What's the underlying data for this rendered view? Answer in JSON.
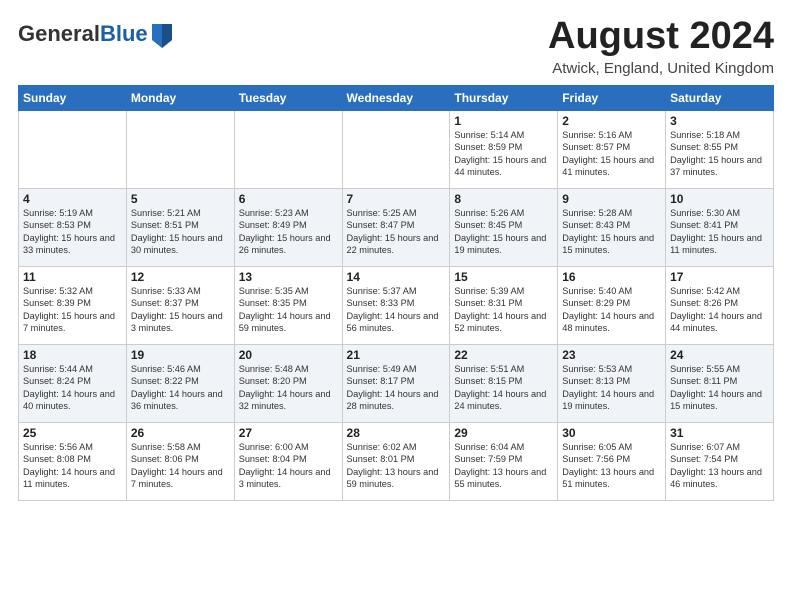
{
  "header": {
    "logo_general": "General",
    "logo_blue": "Blue",
    "month": "August 2024",
    "location": "Atwick, England, United Kingdom"
  },
  "weekdays": [
    "Sunday",
    "Monday",
    "Tuesday",
    "Wednesday",
    "Thursday",
    "Friday",
    "Saturday"
  ],
  "weeks": [
    [
      {
        "day": "",
        "sunrise": "",
        "sunset": "",
        "daylight": ""
      },
      {
        "day": "",
        "sunrise": "",
        "sunset": "",
        "daylight": ""
      },
      {
        "day": "",
        "sunrise": "",
        "sunset": "",
        "daylight": ""
      },
      {
        "day": "",
        "sunrise": "",
        "sunset": "",
        "daylight": ""
      },
      {
        "day": "1",
        "sunrise": "Sunrise: 5:14 AM",
        "sunset": "Sunset: 8:59 PM",
        "daylight": "Daylight: 15 hours and 44 minutes."
      },
      {
        "day": "2",
        "sunrise": "Sunrise: 5:16 AM",
        "sunset": "Sunset: 8:57 PM",
        "daylight": "Daylight: 15 hours and 41 minutes."
      },
      {
        "day": "3",
        "sunrise": "Sunrise: 5:18 AM",
        "sunset": "Sunset: 8:55 PM",
        "daylight": "Daylight: 15 hours and 37 minutes."
      }
    ],
    [
      {
        "day": "4",
        "sunrise": "Sunrise: 5:19 AM",
        "sunset": "Sunset: 8:53 PM",
        "daylight": "Daylight: 15 hours and 33 minutes."
      },
      {
        "day": "5",
        "sunrise": "Sunrise: 5:21 AM",
        "sunset": "Sunset: 8:51 PM",
        "daylight": "Daylight: 15 hours and 30 minutes."
      },
      {
        "day": "6",
        "sunrise": "Sunrise: 5:23 AM",
        "sunset": "Sunset: 8:49 PM",
        "daylight": "Daylight: 15 hours and 26 minutes."
      },
      {
        "day": "7",
        "sunrise": "Sunrise: 5:25 AM",
        "sunset": "Sunset: 8:47 PM",
        "daylight": "Daylight: 15 hours and 22 minutes."
      },
      {
        "day": "8",
        "sunrise": "Sunrise: 5:26 AM",
        "sunset": "Sunset: 8:45 PM",
        "daylight": "Daylight: 15 hours and 19 minutes."
      },
      {
        "day": "9",
        "sunrise": "Sunrise: 5:28 AM",
        "sunset": "Sunset: 8:43 PM",
        "daylight": "Daylight: 15 hours and 15 minutes."
      },
      {
        "day": "10",
        "sunrise": "Sunrise: 5:30 AM",
        "sunset": "Sunset: 8:41 PM",
        "daylight": "Daylight: 15 hours and 11 minutes."
      }
    ],
    [
      {
        "day": "11",
        "sunrise": "Sunrise: 5:32 AM",
        "sunset": "Sunset: 8:39 PM",
        "daylight": "Daylight: 15 hours and 7 minutes."
      },
      {
        "day": "12",
        "sunrise": "Sunrise: 5:33 AM",
        "sunset": "Sunset: 8:37 PM",
        "daylight": "Daylight: 15 hours and 3 minutes."
      },
      {
        "day": "13",
        "sunrise": "Sunrise: 5:35 AM",
        "sunset": "Sunset: 8:35 PM",
        "daylight": "Daylight: 14 hours and 59 minutes."
      },
      {
        "day": "14",
        "sunrise": "Sunrise: 5:37 AM",
        "sunset": "Sunset: 8:33 PM",
        "daylight": "Daylight: 14 hours and 56 minutes."
      },
      {
        "day": "15",
        "sunrise": "Sunrise: 5:39 AM",
        "sunset": "Sunset: 8:31 PM",
        "daylight": "Daylight: 14 hours and 52 minutes."
      },
      {
        "day": "16",
        "sunrise": "Sunrise: 5:40 AM",
        "sunset": "Sunset: 8:29 PM",
        "daylight": "Daylight: 14 hours and 48 minutes."
      },
      {
        "day": "17",
        "sunrise": "Sunrise: 5:42 AM",
        "sunset": "Sunset: 8:26 PM",
        "daylight": "Daylight: 14 hours and 44 minutes."
      }
    ],
    [
      {
        "day": "18",
        "sunrise": "Sunrise: 5:44 AM",
        "sunset": "Sunset: 8:24 PM",
        "daylight": "Daylight: 14 hours and 40 minutes."
      },
      {
        "day": "19",
        "sunrise": "Sunrise: 5:46 AM",
        "sunset": "Sunset: 8:22 PM",
        "daylight": "Daylight: 14 hours and 36 minutes."
      },
      {
        "day": "20",
        "sunrise": "Sunrise: 5:48 AM",
        "sunset": "Sunset: 8:20 PM",
        "daylight": "Daylight: 14 hours and 32 minutes."
      },
      {
        "day": "21",
        "sunrise": "Sunrise: 5:49 AM",
        "sunset": "Sunset: 8:17 PM",
        "daylight": "Daylight: 14 hours and 28 minutes."
      },
      {
        "day": "22",
        "sunrise": "Sunrise: 5:51 AM",
        "sunset": "Sunset: 8:15 PM",
        "daylight": "Daylight: 14 hours and 24 minutes."
      },
      {
        "day": "23",
        "sunrise": "Sunrise: 5:53 AM",
        "sunset": "Sunset: 8:13 PM",
        "daylight": "Daylight: 14 hours and 19 minutes."
      },
      {
        "day": "24",
        "sunrise": "Sunrise: 5:55 AM",
        "sunset": "Sunset: 8:11 PM",
        "daylight": "Daylight: 14 hours and 15 minutes."
      }
    ],
    [
      {
        "day": "25",
        "sunrise": "Sunrise: 5:56 AM",
        "sunset": "Sunset: 8:08 PM",
        "daylight": "Daylight: 14 hours and 11 minutes."
      },
      {
        "day": "26",
        "sunrise": "Sunrise: 5:58 AM",
        "sunset": "Sunset: 8:06 PM",
        "daylight": "Daylight: 14 hours and 7 minutes."
      },
      {
        "day": "27",
        "sunrise": "Sunrise: 6:00 AM",
        "sunset": "Sunset: 8:04 PM",
        "daylight": "Daylight: 14 hours and 3 minutes."
      },
      {
        "day": "28",
        "sunrise": "Sunrise: 6:02 AM",
        "sunset": "Sunset: 8:01 PM",
        "daylight": "Daylight: 13 hours and 59 minutes."
      },
      {
        "day": "29",
        "sunrise": "Sunrise: 6:04 AM",
        "sunset": "Sunset: 7:59 PM",
        "daylight": "Daylight: 13 hours and 55 minutes."
      },
      {
        "day": "30",
        "sunrise": "Sunrise: 6:05 AM",
        "sunset": "Sunset: 7:56 PM",
        "daylight": "Daylight: 13 hours and 51 minutes."
      },
      {
        "day": "31",
        "sunrise": "Sunrise: 6:07 AM",
        "sunset": "Sunset: 7:54 PM",
        "daylight": "Daylight: 13 hours and 46 minutes."
      }
    ]
  ]
}
